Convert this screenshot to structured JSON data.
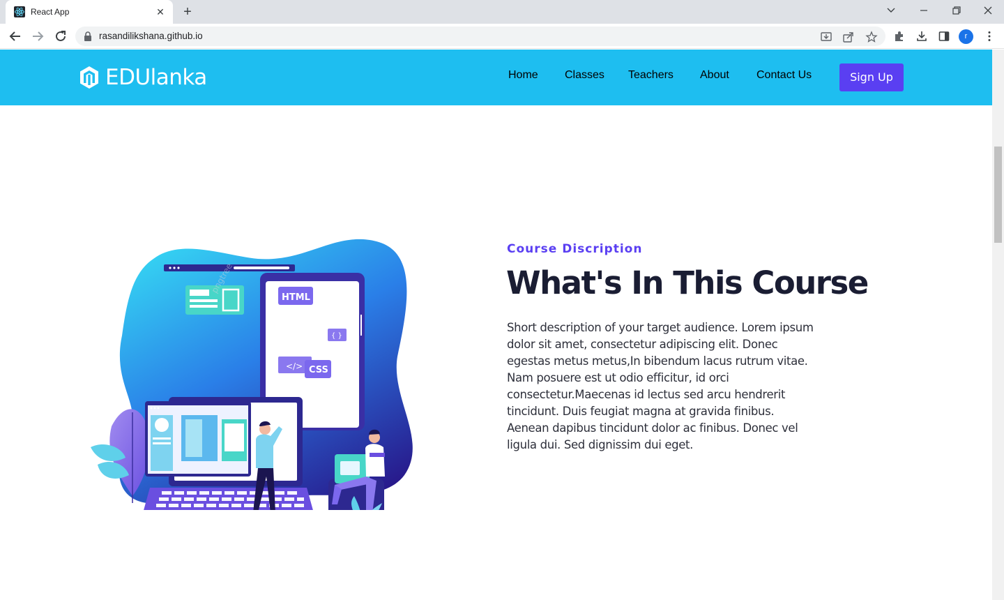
{
  "browser": {
    "tab_title": "React App",
    "tab_close": "✕",
    "new_tab": "+",
    "url": "rasandilikshana.github.io",
    "profile_initial": "r"
  },
  "site": {
    "brand_name": "EDUlanka",
    "nav": [
      "Home",
      "Classes",
      "Teachers",
      "About",
      "Contact Us"
    ],
    "signup_label": "Sign Up"
  },
  "hero": {
    "eyebrow": "Course Discription",
    "heading": "What's In This Course",
    "description": "Short description of your target audience. Lorem ipsum dolor sit amet, consectetur adipiscing elit. Donec egestas metus metus,In bibendum lacus rutrum vitae. Nam posuere est ut odio efficitur, id orci consectetur.Maecenas id lectus sed arcu hendrerit tincidunt. Duis feugiat magna at gravida finibus. Aenean dapibus tincidunt dolor ac finibus. Donec vel ligula dui. Sed dignissim dui eget."
  },
  "illustration": {
    "label_html": "HTML",
    "label_css": "CSS",
    "label_braces": "{ }",
    "label_code": "</>",
    "watermark": "pngtree"
  },
  "colors": {
    "header_bg": "#1ebef0",
    "accent": "#5a3ff2",
    "nav_text": "#2a2f7a",
    "heading": "#1a1d33"
  }
}
